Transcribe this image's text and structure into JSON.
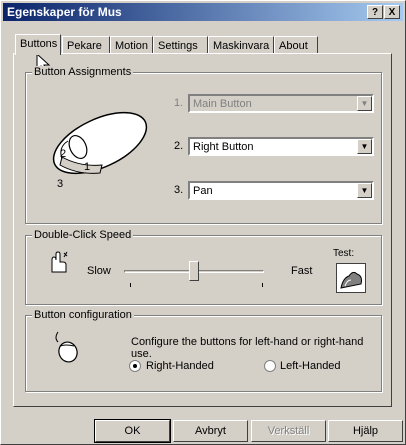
{
  "window": {
    "title": "Egenskaper för Mus",
    "help_btn": "?",
    "close_btn": "X"
  },
  "tabs": [
    "Buttons",
    "Pekare",
    "Motion",
    "Settings",
    "Maskinvara",
    "About"
  ],
  "assignments": {
    "group_label": "Button Assignments",
    "rows": [
      {
        "num": "1.",
        "value": "Main Button"
      },
      {
        "num": "2.",
        "value": "Right Button"
      },
      {
        "num": "3.",
        "value": "Pan"
      }
    ],
    "mouse_labels": [
      "2",
      "1",
      "3"
    ]
  },
  "double_click": {
    "group_label": "Double-Click Speed",
    "slow": "Slow",
    "fast": "Fast",
    "test": "Test:",
    "speed": 0.5
  },
  "configuration": {
    "group_label": "Button configuration",
    "description": "Configure the buttons for left-hand or right-hand use.",
    "right": "Right-Handed",
    "left": "Left-Handed"
  },
  "buttons": {
    "ok": "OK",
    "cancel": "Avbryt",
    "apply": "Verkställ",
    "help": "Hjälp"
  }
}
